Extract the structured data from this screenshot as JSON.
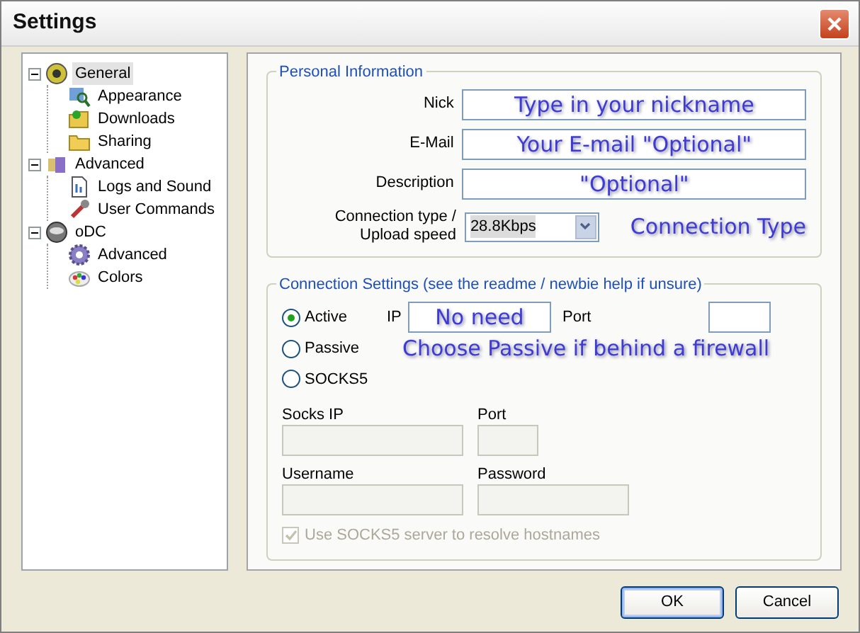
{
  "window": {
    "title": "Settings"
  },
  "tree": [
    {
      "label": "General",
      "selected": true,
      "expanded": true,
      "children": [
        {
          "label": "Appearance",
          "selected": false
        },
        {
          "label": "Downloads",
          "selected": false
        },
        {
          "label": "Sharing",
          "selected": false
        }
      ]
    },
    {
      "label": "Advanced",
      "selected": false,
      "expanded": true,
      "children": [
        {
          "label": "Logs and Sound",
          "selected": false
        },
        {
          "label": "User Commands",
          "selected": false
        }
      ]
    },
    {
      "label": "oDC",
      "selected": false,
      "expanded": true,
      "children": [
        {
          "label": "Advanced",
          "selected": false
        },
        {
          "label": "Colors",
          "selected": false
        }
      ]
    }
  ],
  "personal_information": {
    "title": "Personal Information",
    "fields": [
      {
        "label": "Nick",
        "value": "Type in your nickname"
      },
      {
        "label": "E-Mail",
        "value": "Your E-mail \"Optional\""
      },
      {
        "label": "Description",
        "value": "\"Optional\""
      }
    ],
    "connection_type": {
      "label_lines": [
        "Connection type /",
        "Upload speed"
      ],
      "value": "28.8Kbps"
    },
    "annotation": "Connection Type"
  },
  "connection_settings": {
    "title": "Connection Settings (see the readme / newbie help if unsure)",
    "modes": [
      {
        "label": "Active",
        "selected": true
      },
      {
        "label": "Passive",
        "selected": false
      },
      {
        "label": "SOCKS5",
        "selected": false
      }
    ],
    "ip": {
      "label": "IP",
      "value": "No need"
    },
    "port": {
      "label": "Port"
    },
    "annotation": "Choose Passive if behind a firewall",
    "socks_fields": [
      {
        "label": "Socks IP",
        "disabled": true
      },
      {
        "label": "Port",
        "disabled": true
      },
      {
        "label": "Username",
        "disabled": true
      },
      {
        "label": "Password",
        "disabled": true
      }
    ],
    "resolve": {
      "label": "Use SOCKS5 server to resolve hostnames",
      "checked": true,
      "disabled": true
    }
  },
  "buttons": [
    {
      "label": "OK",
      "default": true
    },
    {
      "label": "Cancel",
      "default": false
    }
  ]
}
